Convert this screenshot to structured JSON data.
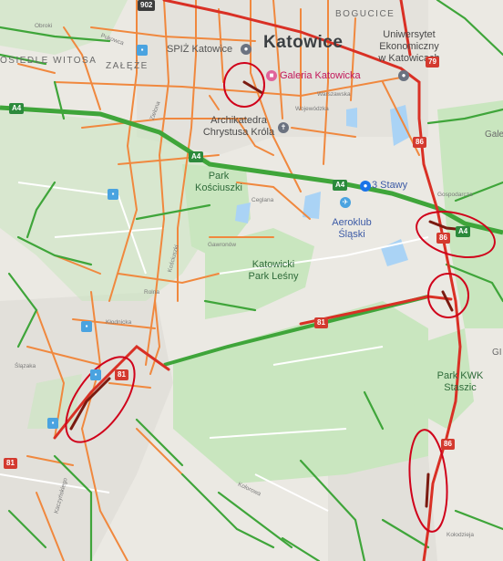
{
  "map": {
    "city": "Katowice",
    "districts": [
      "BOGUCICE",
      "OSIEDLE WITOSA",
      "ZAŁĘŻE",
      "Gale",
      "GI"
    ],
    "parks": {
      "kosciuszki": "Park\nKościuszki",
      "lesny": "Katowicki\nPark Leśny",
      "kwk": "Park KWK\nStaszic"
    },
    "pois": {
      "spiz": "SPIŻ Katowice",
      "galeria": "Galeria Katowicka",
      "uniwersytet": "Uniwersytet\nEkonomiczny\nw Katowicach",
      "archikatedra": "Archikatedra\nChrystusa Króla",
      "staw": "3 Stawy",
      "aeroklub": "Aeroklub\nŚląski"
    },
    "streets": [
      "Obroki",
      "Pukowca",
      "Warszawska",
      "Wojewódzka",
      "Gospodarcza",
      "Kłodnicka",
      "Ślązaka",
      "Rolna",
      "Gawronów",
      "Ceglana",
      "Zielona",
      "Kolorowa",
      "Kołodzieja",
      "Kaczyńskiego",
      "Kościuszki"
    ],
    "road_shields": {
      "r902": "902",
      "a4_left": "A4",
      "a4_mid": "A4",
      "a4_center": "A4",
      "a4_right": "A4",
      "r79": "79",
      "r86_top": "86",
      "r86_mid": "86",
      "r86_bottom": "86",
      "r81_center": "81",
      "r81_left": "81",
      "r81_edge": "81"
    },
    "colors": {
      "traffic_free": "#3fa53a",
      "traffic_medium": "#f2853a",
      "traffic_heavy": "#d93025",
      "traffic_severe": "#7a1a10",
      "highlight_circle": "#d0021b",
      "park_fill": "#c5e4b9",
      "water_fill": "#a8d0f2"
    },
    "icons": [
      "shopping-bag-icon",
      "shopping-bag-icon",
      "church-icon",
      "airplane-icon",
      "pin-icon",
      "bus-stop-icon"
    ]
  }
}
